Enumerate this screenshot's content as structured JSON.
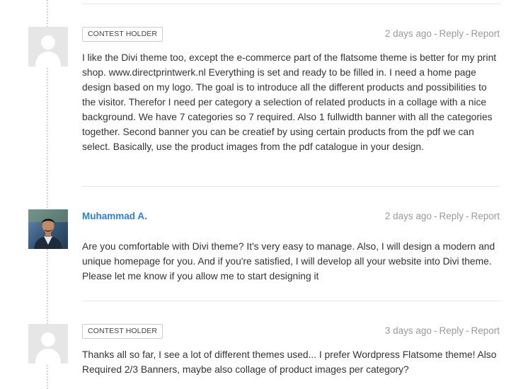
{
  "comments": [
    {
      "avatar": "default-avatar",
      "badge": "CONTEST HOLDER",
      "time": "2 days ago",
      "reply_label": "Reply",
      "report_label": "Report",
      "text": "I like the Divi theme too, except the e-commerce part of the flatsome theme is better for my print shop. www.directprintwerk.nl Everything is set and ready to be filled in. I need a home page design based on my logo. The goal is to introduce all the different products and possibilities to the visitor. Therefor I need per category a selection of related products in a collage with a nice background. We have 7 categories so 7 required. Also 1 fullwidth banner with all the categories together. Second banner you can be creatief by using certain products from the pdf we can select. Basically, use the product images from the pdf catalogue in your design."
    },
    {
      "avatar": "user-photo-avatar",
      "author": "Muhammad A.",
      "time": "2 days ago",
      "reply_label": "Reply",
      "report_label": "Report",
      "text": "Are you comfortable with Divi theme? It's very easy to manage. Also, I will design a modern and unique homepage for you. And if you're satisfied, I will develop all your website into Divi theme. Please let me know if you allow me to start designing it"
    },
    {
      "avatar": "default-avatar",
      "badge": "CONTEST HOLDER",
      "time": "3 days ago",
      "reply_label": "Reply",
      "report_label": "Report",
      "text": "Thanks all so far, I see a lot of different themes used... I prefer Wordpress Flatsome theme! Also Required 2/3 Banners, maybe also collage of product images per category?"
    }
  ],
  "colors": {
    "author_link": "#2d7fd3",
    "meta_text": "#9a9a9a",
    "body_text": "#333333",
    "divider": "#e5e5e5"
  }
}
